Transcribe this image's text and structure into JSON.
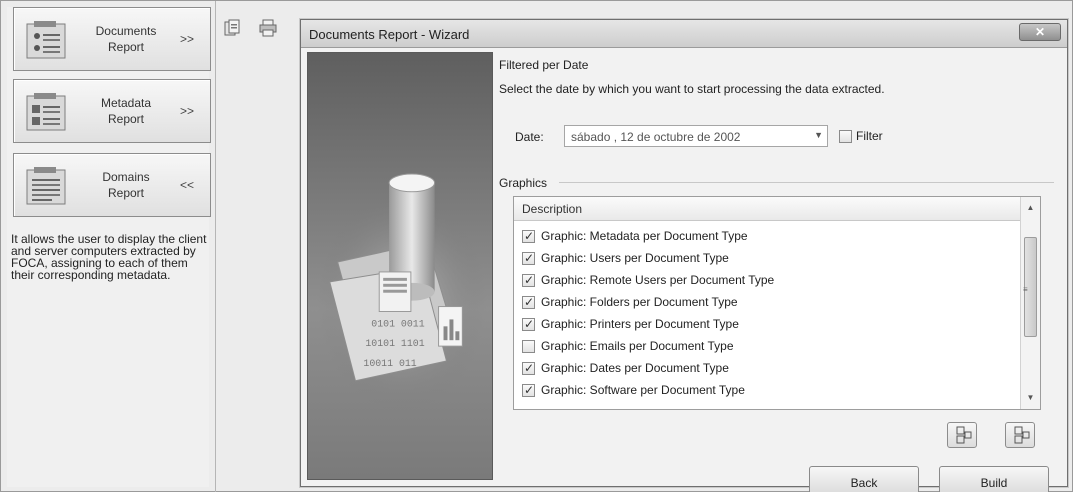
{
  "left_panel": {
    "nav": [
      {
        "line1": "Documents",
        "line2": "Report",
        "arrow": ">>"
      },
      {
        "line1": "Metadata",
        "line2": "Report",
        "arrow": ">>"
      },
      {
        "line1": "Domains",
        "line2": "Report",
        "arrow": "<<"
      }
    ],
    "description": "It allows the user to display the client and server computers extracted by FOCA, assigning to each of them their corresponding metadata."
  },
  "toolbar": {
    "icons": [
      "report-icon",
      "print-icon"
    ]
  },
  "wizard": {
    "title": "Documents Report - Wizard",
    "close_label": "✕",
    "filtered_title": "Filtered per Date",
    "filtered_instruction": "Select the date by which you want to start processing the data extracted.",
    "date_label": "Date:",
    "date_value": "sábado , 12 de  octubre  de 2002",
    "date_dropdown": "▼",
    "filter_label": "Filter",
    "filter_checked": false,
    "graphics_title": "Graphics",
    "list_header": "Description",
    "items": [
      {
        "label": "Graphic: Metadata per Document Type",
        "checked": true
      },
      {
        "label": "Graphic: Users per Document Type",
        "checked": true
      },
      {
        "label": "Graphic: Remote Users per Document Type",
        "checked": true
      },
      {
        "label": "Graphic: Folders per Document Type",
        "checked": true
      },
      {
        "label": "Graphic: Printers per Document Type",
        "checked": true
      },
      {
        "label": "Graphic: Emails per Document Type",
        "checked": false
      },
      {
        "label": "Graphic: Dates per Document Type",
        "checked": true
      },
      {
        "label": "Graphic: Software per Document Type",
        "checked": true
      }
    ],
    "scroll_grip": "≡",
    "scroll_up": "▲",
    "scroll_down": "▼",
    "back_label": "Back",
    "build_label": "Build"
  },
  "colors": {
    "window_bg": "#ececec",
    "titlebar": "#d6d6d6",
    "side_image": "#7b7b7b"
  }
}
